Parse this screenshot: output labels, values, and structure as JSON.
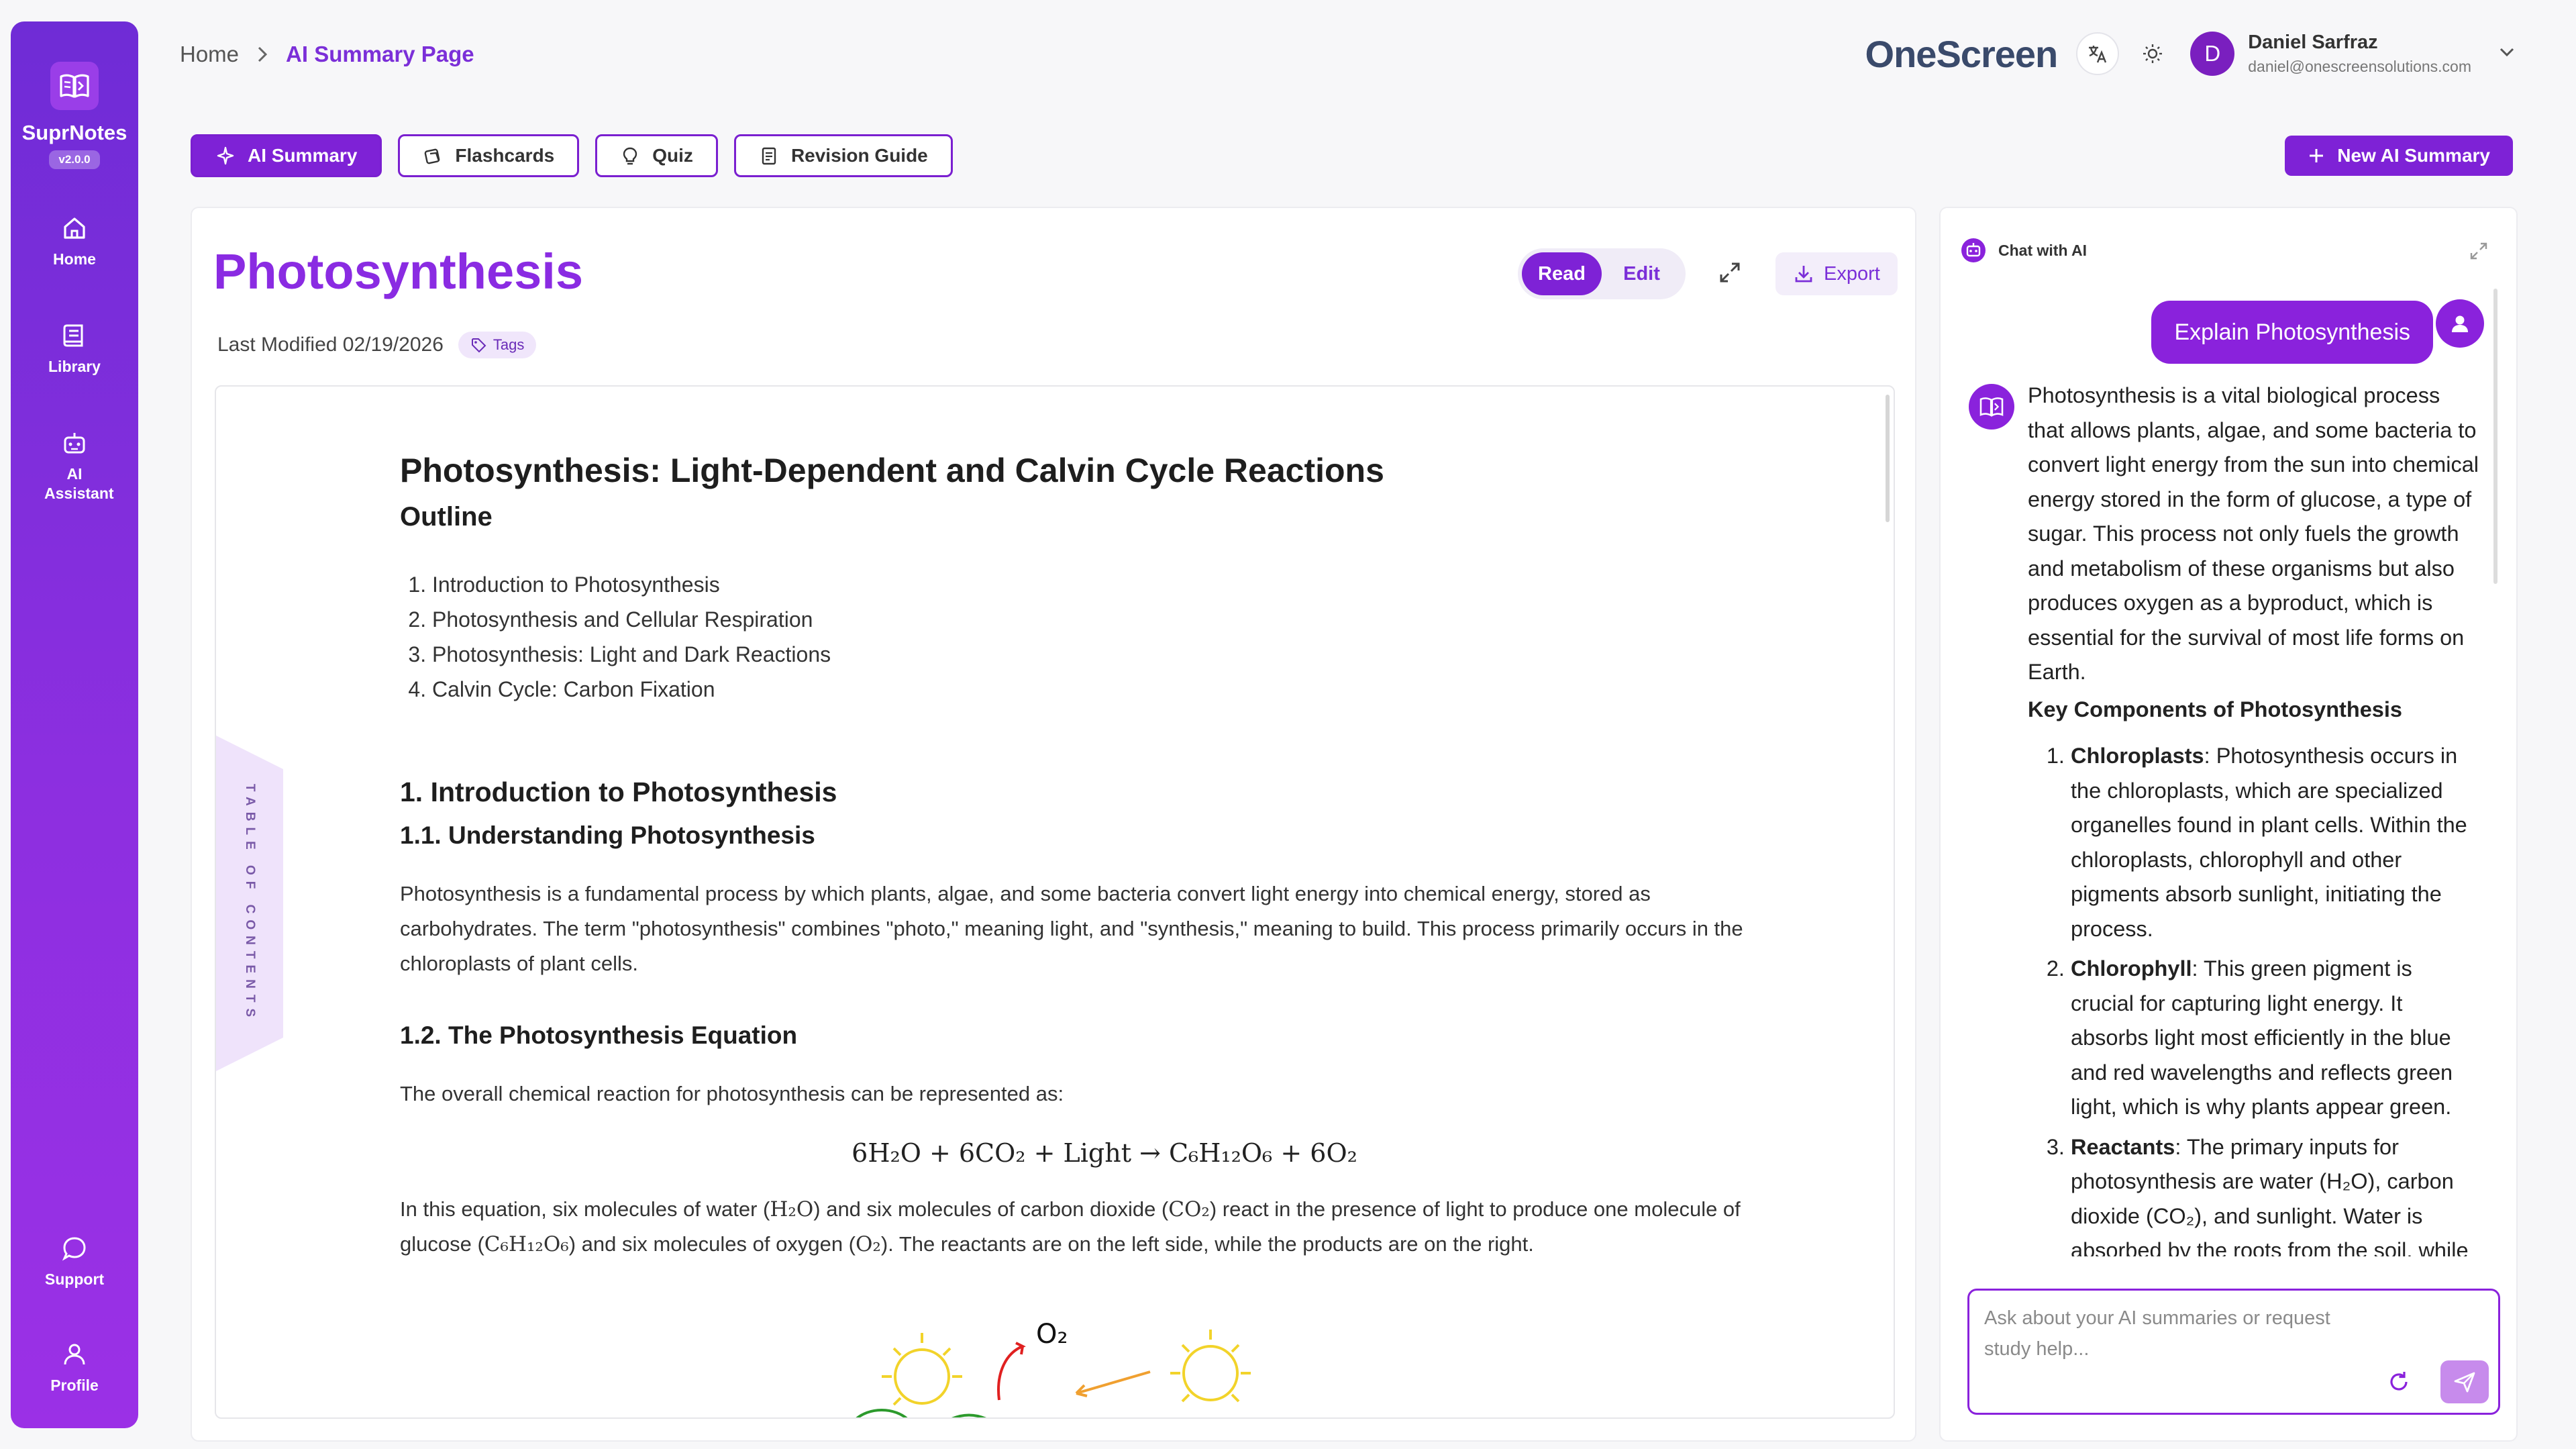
{
  "app": {
    "name": "SuprNotes",
    "version": "v2.0.0"
  },
  "sidebar": {
    "items": [
      {
        "label": "Home",
        "icon": "home-icon"
      },
      {
        "label": "Library",
        "icon": "library-icon"
      },
      {
        "label": "AI Assistant",
        "icon": "robot-icon"
      },
      {
        "label": "Support",
        "icon": "chat-bubble-icon"
      },
      {
        "label": "Profile",
        "icon": "user-icon"
      }
    ]
  },
  "breadcrumb": {
    "home": "Home",
    "current": "AI Summary Page"
  },
  "header": {
    "brand": "OneScreen",
    "user_name": "Daniel Sarfraz",
    "user_email": "daniel@onescreensolutions.com",
    "avatar_initial": "D"
  },
  "tabs": [
    {
      "label": "AI Summary",
      "active": true
    },
    {
      "label": "Flashcards",
      "active": false
    },
    {
      "label": "Quiz",
      "active": false
    },
    {
      "label": "Revision Guide",
      "active": false
    }
  ],
  "actions": {
    "new_summary": "New AI Summary"
  },
  "document": {
    "title": "Photosynthesis",
    "last_modified": "Last Modified 02/19/2026",
    "tags_label": "Tags",
    "mode_read": "Read",
    "mode_edit": "Edit",
    "export_label": "Export",
    "toc_label": "TABLE OF CONTENTS",
    "heading": "Photosynthesis: Light-Dependent and Calvin Cycle Reactions",
    "outline_heading": "Outline",
    "outline": [
      "Introduction to Photosynthesis",
      "Photosynthesis and Cellular Respiration",
      "Photosynthesis: Light and Dark Reactions",
      "Calvin Cycle: Carbon Fixation"
    ],
    "section1": "1. Introduction to Photosynthesis",
    "section1_1": "1.1. Understanding Photosynthesis",
    "section1_1_text": "Photosynthesis is a fundamental process by which plants, algae, and some bacteria convert light energy into chemical energy, stored as carbohydrates. The term \"photosynthesis\" combines \"photo,\" meaning light, and \"synthesis,\" meaning to build. This process primarily occurs in the chloroplasts of plant cells.",
    "section1_2": "1.2. The Photosynthesis Equation",
    "section1_2_intro": "The overall chemical reaction for photosynthesis can be represented as:",
    "equation": "6H₂O + 6CO₂ + Light → C₆H₁₂O₆ + 6O₂",
    "eq_text_1": "In this equation, six molecules of water (",
    "eq_water": "H₂O",
    "eq_text_2": ") and six molecules of carbon dioxide (",
    "eq_co2": "CO₂",
    "eq_text_3": ") react in the presence of light to produce one molecule of glucose (",
    "eq_glucose": "C₆H₁₂O₆",
    "eq_text_4": ") and six molecules of oxygen (",
    "eq_o2": "O₂",
    "eq_text_5": "). The reactants are on the left side, while the products are on the right.",
    "drawing_label": "O₂"
  },
  "chat": {
    "title": "Chat with AI",
    "user_message": "Explain Photosynthesis",
    "bot_intro": "Photosynthesis is a vital biological process that allows plants, algae, and some bacteria to convert light energy from the sun into chemical energy stored in the form of glucose, a type of sugar. This process not only fuels the growth and metabolism of these organisms but also produces oxygen as a byproduct, which is essential for the survival of most life forms on Earth.",
    "bot_heading": "Key Components of Photosynthesis",
    "components": [
      {
        "term": "Chloroplasts",
        "text": ": Photosynthesis occurs in the chloroplasts, which are specialized organelles found in plant cells. Within the chloroplasts, chlorophyll and other pigments absorb sunlight, initiating the process."
      },
      {
        "term": "Chlorophyll",
        "text": ": This green pigment is crucial for capturing light energy. It absorbs light most efficiently in the blue and red wavelengths and reflects green light, which is why plants appear green."
      },
      {
        "term": "Reactants",
        "text": ": The primary inputs for photosynthesis are water (H₂O), carbon dioxide (CO₂), and sunlight. Water is absorbed by the roots from the soil, while carbon dioxide enters through the stomata."
      }
    ],
    "input_placeholder": "Ask about your AI summaries or request study help..."
  },
  "colors": {
    "accent": "#7e22d6",
    "title": "#8a2be2",
    "sidebar_top": "#6f2cd6",
    "sidebar_bottom": "#9b30e6"
  }
}
